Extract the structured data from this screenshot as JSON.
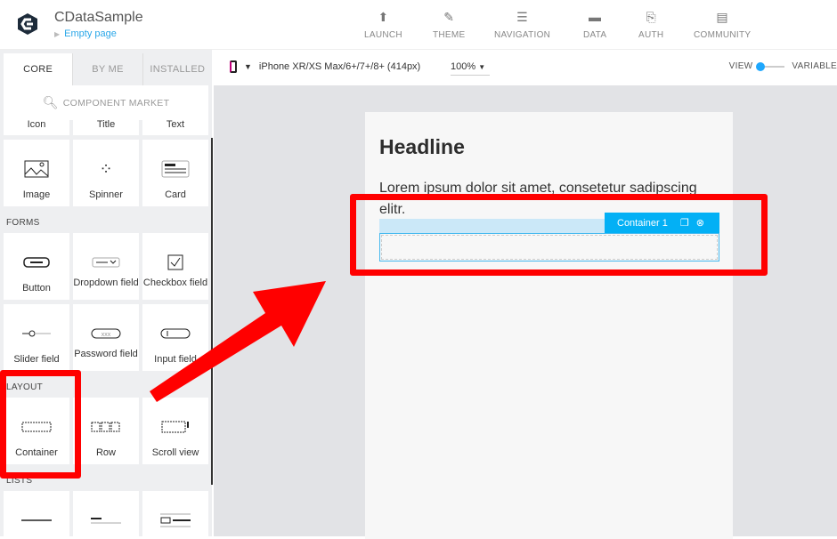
{
  "header": {
    "app_title": "CDataSample",
    "page": "Empty page",
    "nav": [
      {
        "label": "LAUNCH",
        "icon": "upload-circle-icon"
      },
      {
        "label": "THEME",
        "icon": "brush-icon"
      },
      {
        "label": "NAVIGATION",
        "icon": "list-icon"
      },
      {
        "label": "DATA",
        "icon": "folder-icon"
      },
      {
        "label": "AUTH",
        "icon": "code-file-icon"
      },
      {
        "label": "COMMUNITY",
        "icon": "chat-icon"
      }
    ]
  },
  "sidebar": {
    "tabs": [
      "CORE",
      "BY ME",
      "INSTALLED"
    ],
    "market": "COMPONENT MARKET",
    "basic_partial": [
      "Icon",
      "Title",
      "Text"
    ],
    "basic": [
      "Image",
      "Spinner",
      "Card"
    ],
    "forms_label": "FORMS",
    "forms": [
      "Button",
      "Dropdown field",
      "Checkbox field",
      "Slider field",
      "Password field",
      "Input field"
    ],
    "layout_label": "LAYOUT",
    "layout": [
      "Container",
      "Row",
      "Scroll view"
    ],
    "lists_label": "LISTS"
  },
  "toolbar": {
    "device": "iPhone XR/XS Max/6+/7+/8+ (414px)",
    "zoom": "100%",
    "toggle_left": "VIEW",
    "toggle_right": "VARIABLE"
  },
  "canvas": {
    "headline": "Headline",
    "body": "Lorem ipsum dolor sit amet, consetetur sadipscing elitr.",
    "selected": "Container 1"
  },
  "colors": {
    "accent": "#03b0f5",
    "annotation": "#ff0000"
  }
}
